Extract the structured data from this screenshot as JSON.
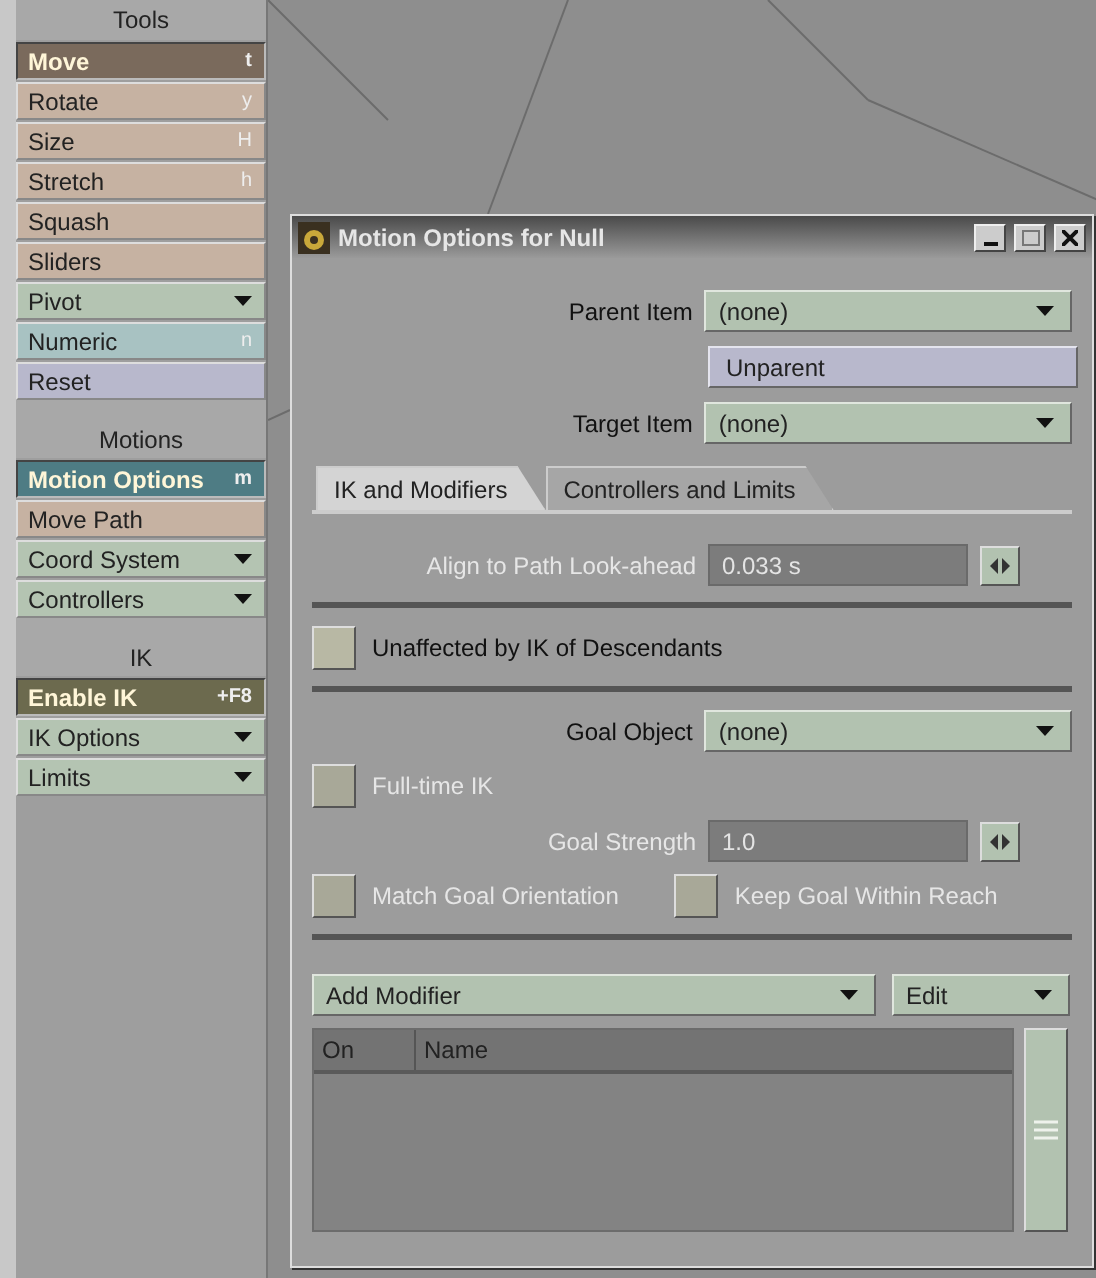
{
  "toolbar": {
    "sections": [
      {
        "title": "Tools",
        "items": [
          {
            "label": "Move",
            "shortcut": "t",
            "kind": "button",
            "color": "#7a6a5c",
            "selected": true
          },
          {
            "label": "Rotate",
            "shortcut": "y",
            "kind": "button",
            "color": "#c6b2a2",
            "selected": false
          },
          {
            "label": "Size",
            "shortcut": "H",
            "kind": "button",
            "color": "#c6b2a2",
            "selected": false
          },
          {
            "label": "Stretch",
            "shortcut": "h",
            "kind": "button",
            "color": "#c6b2a2",
            "selected": false
          },
          {
            "label": "Squash",
            "kind": "button",
            "color": "#c6b2a2",
            "selected": false
          },
          {
            "label": "Sliders",
            "kind": "button",
            "color": "#c6b2a2",
            "selected": false
          },
          {
            "label": "Pivot",
            "kind": "menu",
            "color": "#b4c4b2",
            "selected": false
          },
          {
            "label": "Numeric",
            "shortcut": "n",
            "kind": "button",
            "color": "#a8c2c2",
            "selected": false
          },
          {
            "label": "Reset",
            "kind": "button",
            "color": "#b8b8cc",
            "selected": false
          }
        ]
      },
      {
        "title": "Motions",
        "items": [
          {
            "label": "Motion Options",
            "shortcut": "m",
            "kind": "button",
            "color": "#4e7c84",
            "selected": true
          },
          {
            "label": "Move Path",
            "kind": "button",
            "color": "#c6b2a2",
            "selected": false
          },
          {
            "label": "Coord System",
            "kind": "menu",
            "color": "#b4c4b2",
            "selected": false
          },
          {
            "label": "Controllers",
            "kind": "menu",
            "color": "#b4c4b2",
            "selected": false
          }
        ]
      },
      {
        "title": "IK",
        "items": [
          {
            "label": "Enable IK",
            "shortcut": "+F8",
            "kind": "button",
            "color": "#6c6a4e",
            "selected": true
          },
          {
            "label": "IK Options",
            "kind": "menu",
            "color": "#b4c4b2",
            "selected": false
          },
          {
            "label": "Limits",
            "kind": "menu",
            "color": "#b4c4b2",
            "selected": false
          }
        ]
      }
    ]
  },
  "dialog": {
    "title": "Motion Options for Null",
    "parent_item": {
      "label": "Parent Item",
      "value": "(none)"
    },
    "unparent_button": "Unparent",
    "target_item": {
      "label": "Target Item",
      "value": "(none)"
    },
    "tabs": [
      {
        "label": "IK and Modifiers",
        "selected": true
      },
      {
        "label": "Controllers and Limits",
        "selected": false
      }
    ],
    "align_lookahead": {
      "label": "Align to Path Look-ahead",
      "value": "0.033 s",
      "disabled": true
    },
    "unaffected_checkbox": {
      "label": "Unaffected by IK of Descendants",
      "checked": false,
      "disabled": false
    },
    "goal_object": {
      "label": "Goal Object",
      "value": "(none)"
    },
    "full_time_ik": {
      "label": "Full-time IK",
      "checked": false,
      "disabled": true
    },
    "goal_strength": {
      "label": "Goal Strength",
      "value": "1.0",
      "disabled": true
    },
    "match_goal_orientation": {
      "label": "Match Goal Orientation",
      "checked": false,
      "disabled": true
    },
    "keep_goal_within_reach": {
      "label": "Keep Goal Within Reach",
      "checked": false,
      "disabled": true
    },
    "add_modifier": "Add Modifier",
    "edit_menu": "Edit",
    "modifier_list": {
      "columns": [
        "On",
        "Name"
      ]
    }
  }
}
